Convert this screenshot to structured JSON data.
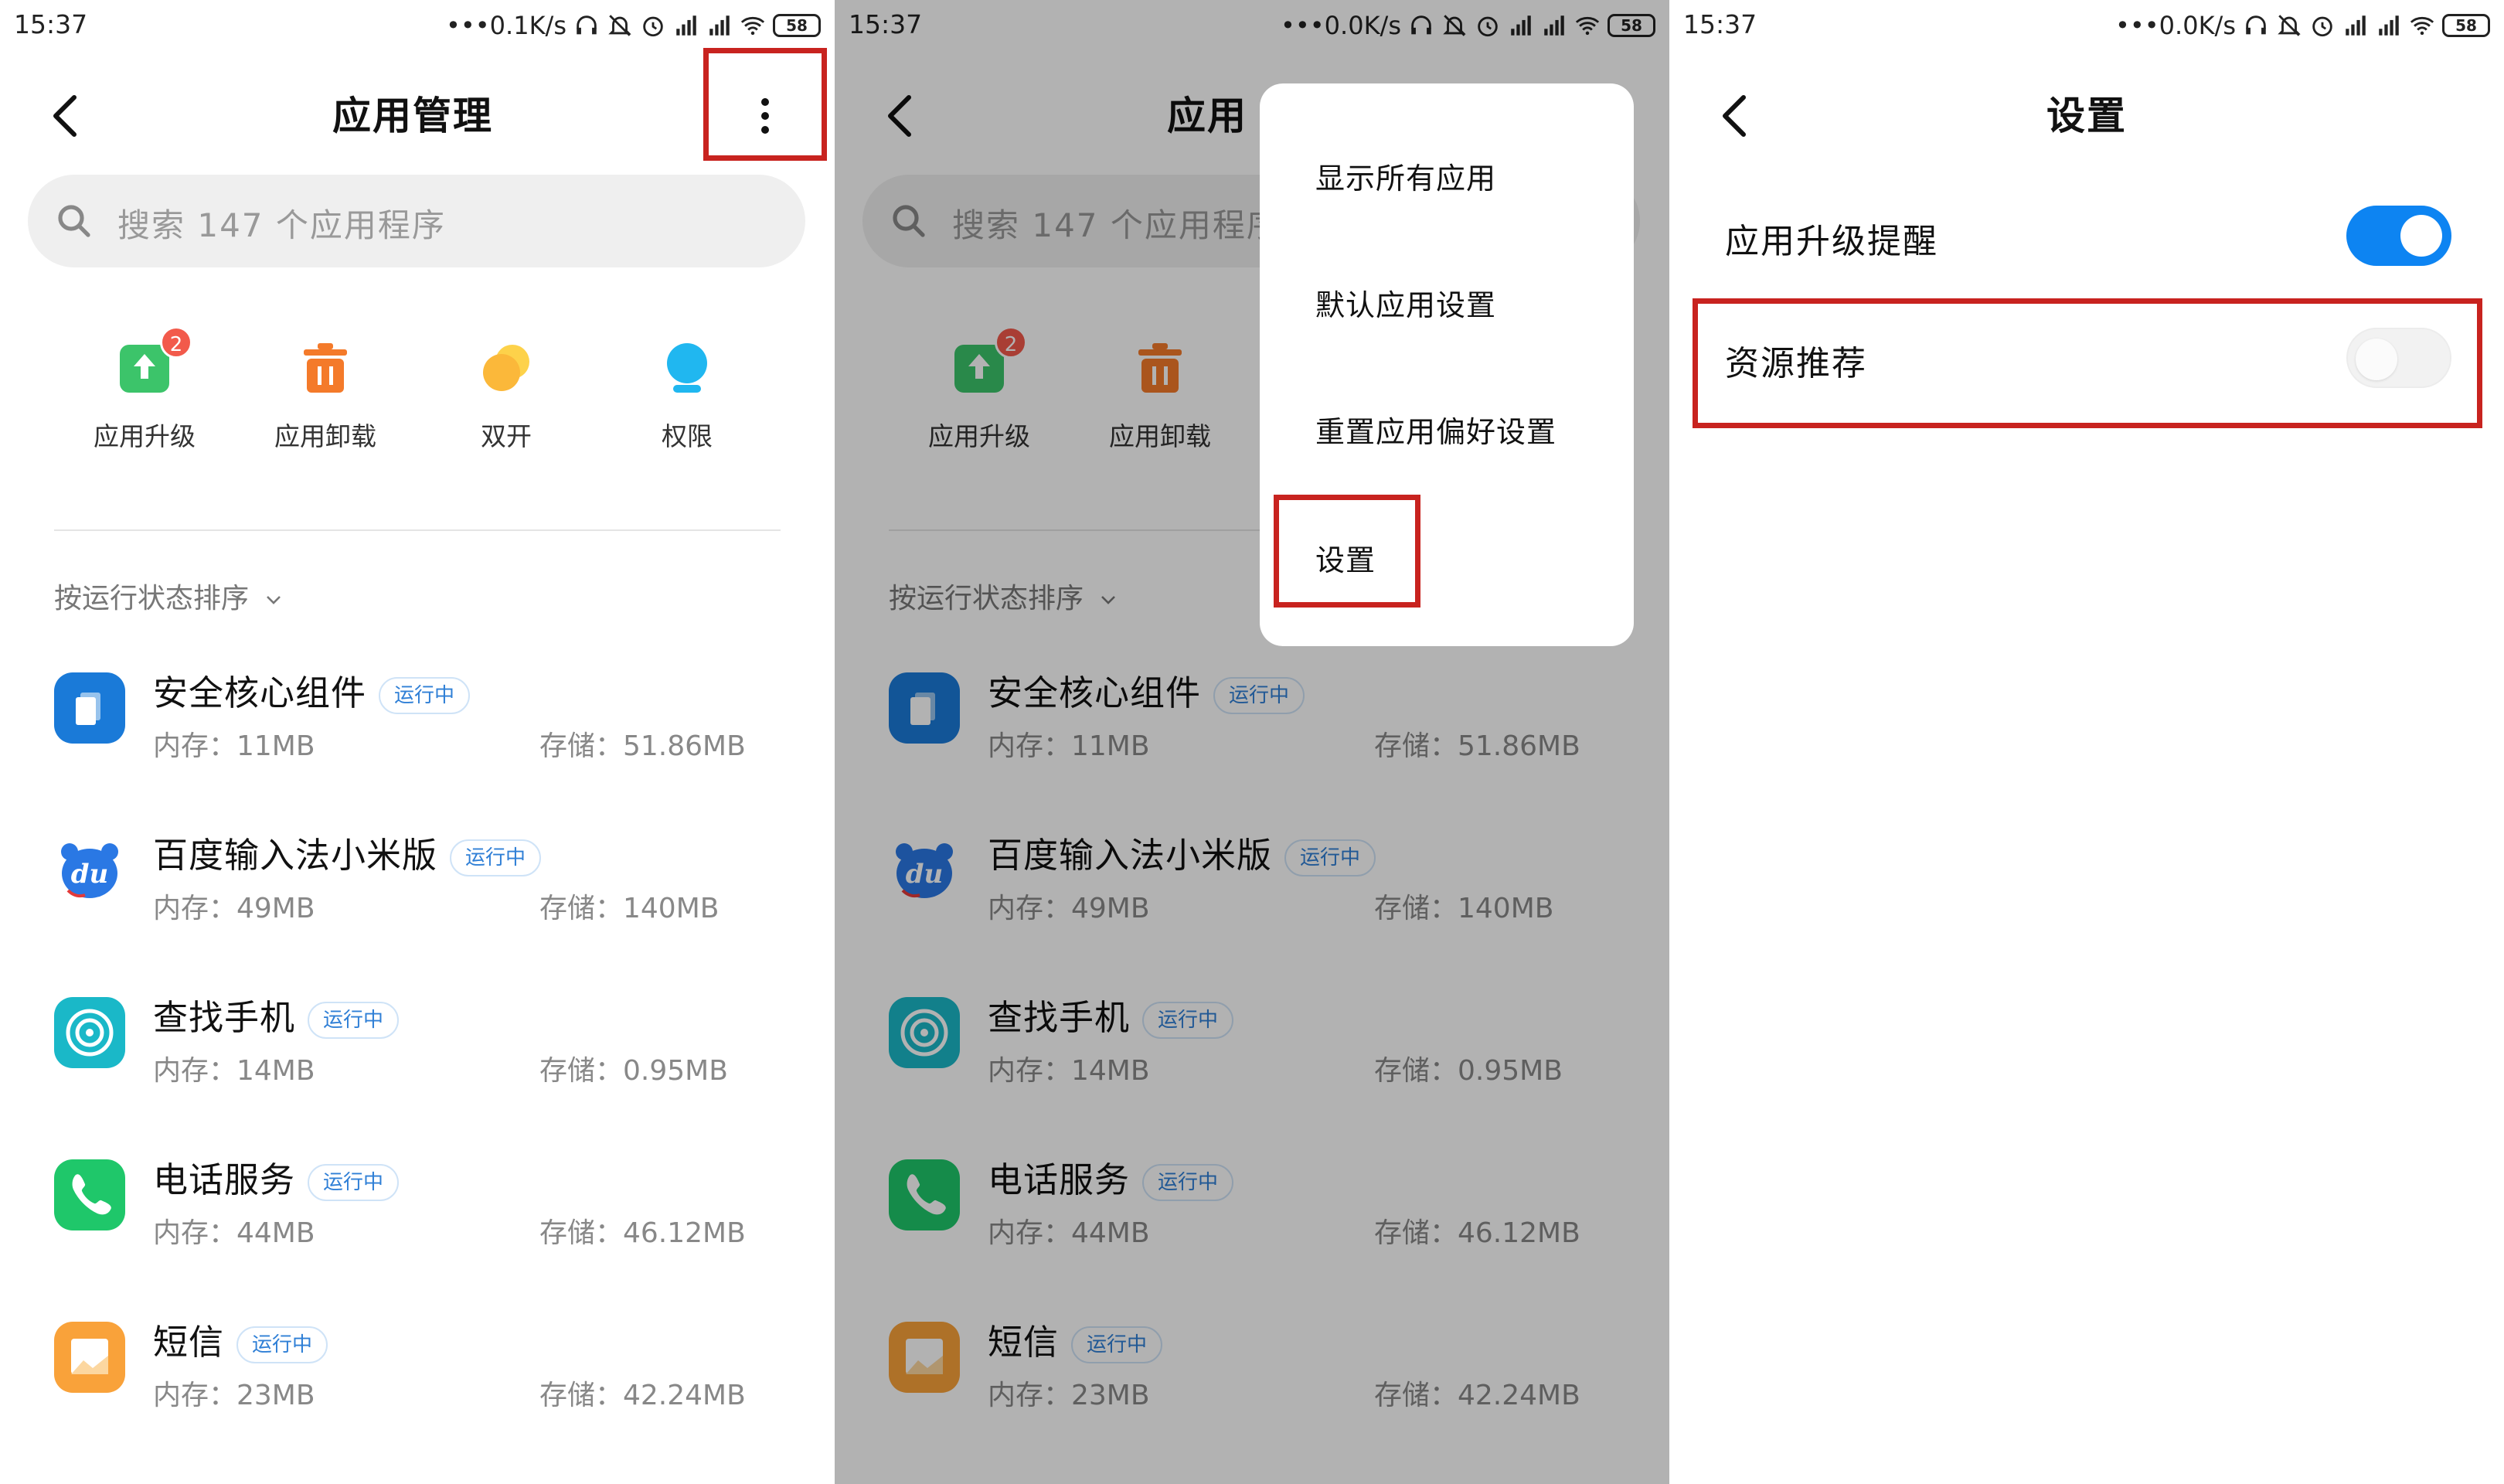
{
  "status_left": {
    "time": "15:37",
    "speed": "0.1K/s",
    "battery": "58"
  },
  "status_mid": {
    "time": "15:37",
    "speed": "0.0K/s",
    "battery": "58"
  },
  "status_right": {
    "time": "15:37",
    "speed": "0.0K/s",
    "battery": "58"
  },
  "app_manager": {
    "title": "应用管理",
    "search_placeholder": "搜索 147 个应用程序",
    "quick_actions": [
      {
        "label": "应用升级",
        "icon": "upgrade-icon",
        "badge": "2",
        "color": "#3cc46a"
      },
      {
        "label": "应用卸载",
        "icon": "trash-icon",
        "color": "#f47a2a"
      },
      {
        "label": "双开",
        "icon": "dual-app-icon",
        "color": "#fbb83a"
      },
      {
        "label": "权限",
        "icon": "permission-icon",
        "color": "#20b7f0"
      }
    ],
    "sort_label": "按运行状态排序",
    "apps": [
      {
        "name": "安全核心组件",
        "tag": "运行中",
        "memory": "内存：11MB",
        "storage": "存储：51.86MB",
        "icon": "security-core-icon",
        "color": "#1a7ad8"
      },
      {
        "name": "百度输入法小米版",
        "tag": "运行中",
        "memory": "内存：49MB",
        "storage": "存储：140MB",
        "icon": "baidu-ime-icon",
        "color": "#2a78e4"
      },
      {
        "name": "查找手机",
        "tag": "运行中",
        "memory": "内存：14MB",
        "storage": "存储：0.95MB",
        "icon": "find-phone-icon",
        "color": "#1ab8c8"
      },
      {
        "name": "电话服务",
        "tag": "运行中",
        "memory": "内存：44MB",
        "storage": "存储：46.12MB",
        "icon": "phone-service-icon",
        "color": "#1fc76a"
      },
      {
        "name": "短信",
        "tag": "运行中",
        "memory": "内存：23MB",
        "storage": "存储：42.24MB",
        "icon": "sms-icon",
        "color": "#f9a23a"
      }
    ],
    "mid_title_partial": "应用",
    "mid_search_partial": "搜索 147 个应用程序"
  },
  "overflow_menu": {
    "items": [
      "显示所有应用",
      "默认应用设置",
      "重置应用偏好设置",
      "设置"
    ]
  },
  "settings": {
    "title": "设置",
    "rows": [
      {
        "label": "应用升级提醒",
        "enabled": true
      },
      {
        "label": "资源推荐",
        "enabled": false
      }
    ]
  },
  "colors": {
    "highlight": "#c8231f",
    "accent": "#0d84f2",
    "tag_text": "#2f7fd6"
  }
}
